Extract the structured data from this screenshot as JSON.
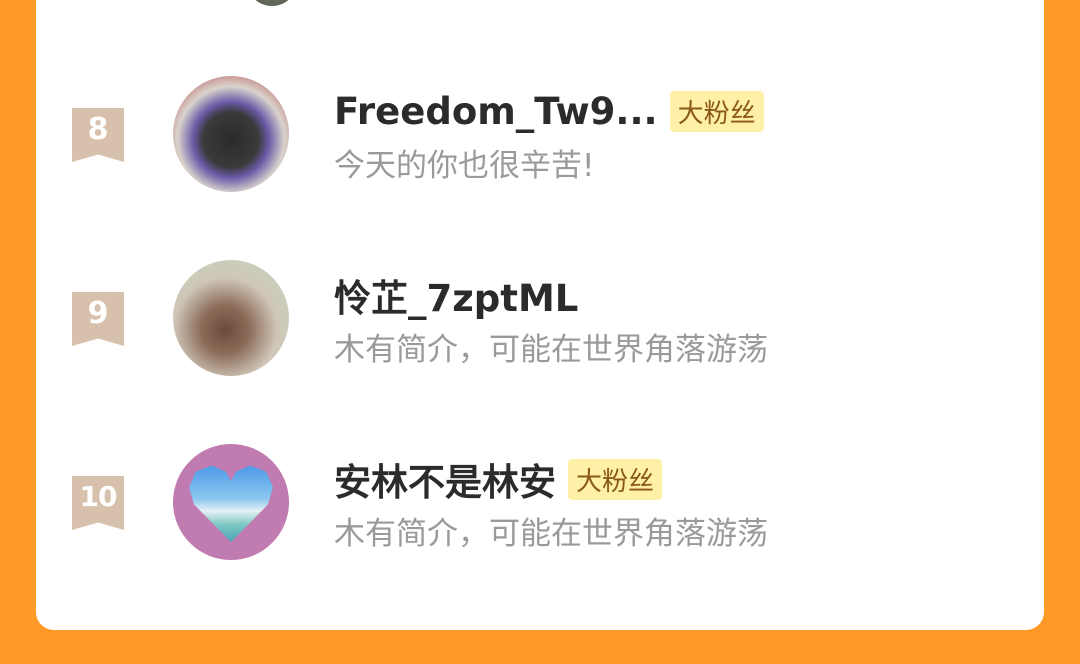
{
  "list": {
    "items": [
      {
        "rank": "8",
        "name": "Freedom_Tw9...",
        "badge": "大粉丝",
        "bio": "今天的你也很辛苦!"
      },
      {
        "rank": "9",
        "name": "怜芷_7zptML",
        "badge": "",
        "bio": "木有简介，可能在世界角落游荡"
      },
      {
        "rank": "10",
        "name": "安林不是林安",
        "badge": "大粉丝",
        "bio": "木有简介，可能在世界角落游荡"
      }
    ]
  },
  "colors": {
    "background": "#FF9A28",
    "card": "#FFFFFF",
    "rank_ribbon": "#D8C1AC",
    "badge_bg": "#FFF0A8",
    "badge_text": "#8A5A14"
  }
}
